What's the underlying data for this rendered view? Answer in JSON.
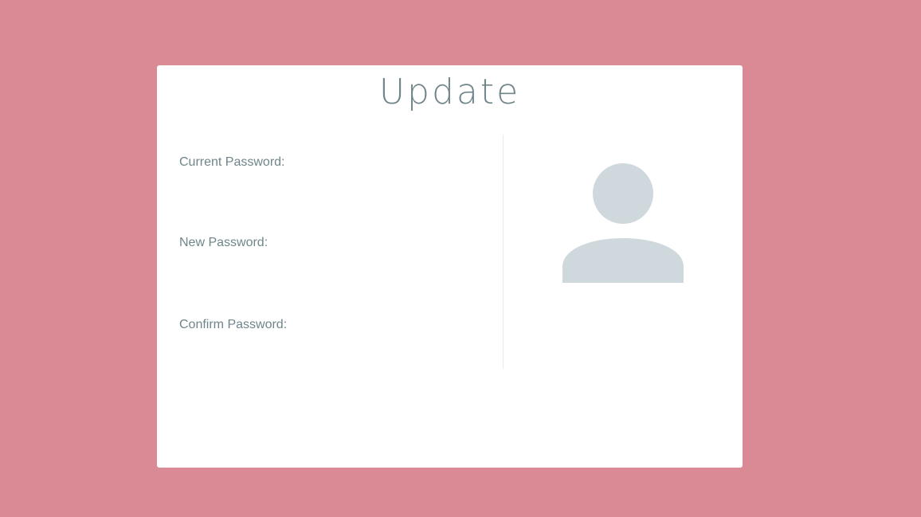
{
  "card": {
    "title": "Update"
  },
  "form": {
    "current_password": {
      "label": "Current Password:",
      "value": "",
      "placeholder": ""
    },
    "new_password": {
      "label": "New Password:",
      "value": "",
      "placeholder": ""
    },
    "confirm_password": {
      "label": "Confirm Password:",
      "value": "",
      "placeholder": ""
    }
  },
  "avatar": {
    "icon": "user-placeholder-icon",
    "color": "#cfd8dc"
  },
  "colors": {
    "background": "#d98a95",
    "card": "#ffffff",
    "text": "#6f8589"
  }
}
